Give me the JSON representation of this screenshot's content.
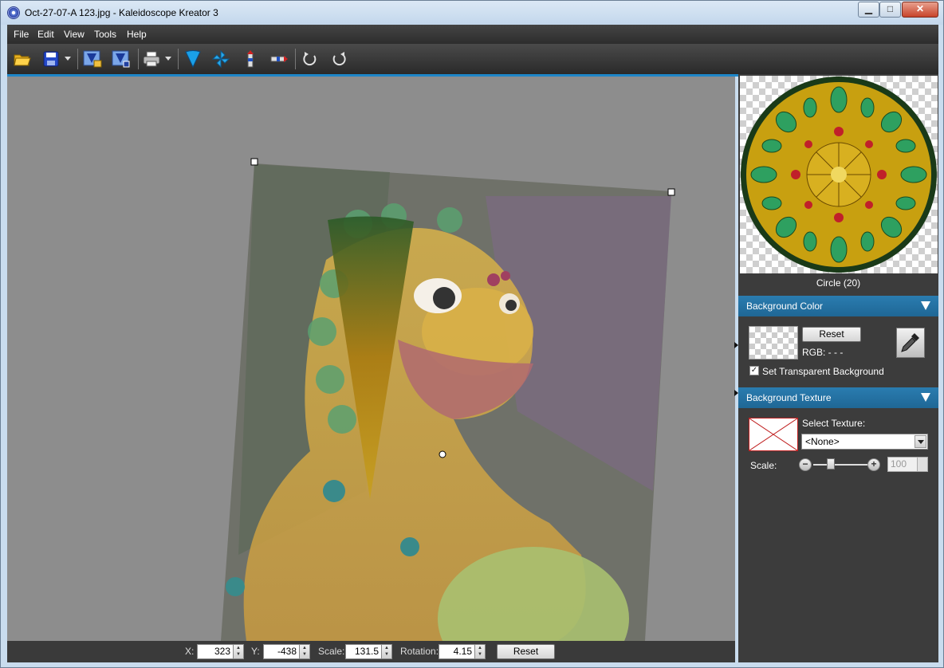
{
  "window": {
    "title": "Oct-27-07-A 123.jpg - Kaleidoscope Kreator 3",
    "minimize_glyph": "▁",
    "maximize_glyph": "□",
    "close_glyph": "✕"
  },
  "menu": [
    "File",
    "Edit",
    "View",
    "Tools",
    "Help"
  ],
  "toolbar": {
    "icons": [
      "open-folder-icon",
      "save-icon",
      "save-dropdown-icon",
      "export-icon",
      "export-settings-icon",
      "print-icon",
      "print-dropdown-icon",
      "wedge-shape-icon",
      "pinwheel-icon",
      "flip-vertical-icon",
      "flip-horizontal-icon",
      "undo-icon",
      "redo-icon"
    ]
  },
  "bottom": {
    "x_label": "X:",
    "x_value": "323",
    "y_label": "Y:",
    "y_value": "-438",
    "scale_label": "Scale:",
    "scale_value": "131.5",
    "rotation_label": "Rotation:",
    "rotation_value": "4.15",
    "reset_label": "Reset"
  },
  "panel": {
    "preview_caption": "Circle (20)",
    "bg_color": {
      "header": "Background Color",
      "reset_label": "Reset",
      "rgb_label": "RGB: - - -",
      "checkbox_label": "Set Transparent Background",
      "checked": true
    },
    "bg_texture": {
      "header": "Background Texture",
      "select_label": "Select Texture:",
      "select_value": "<None>",
      "scale_label": "Scale:",
      "scale_value": "100",
      "minus": "−",
      "plus": "+"
    }
  },
  "colors": {
    "accent": "#1e86c8",
    "header_blue": "#2a7cb0",
    "dark_panel": "#3c3c3c",
    "canvas_gray": "#8d8d8d"
  }
}
